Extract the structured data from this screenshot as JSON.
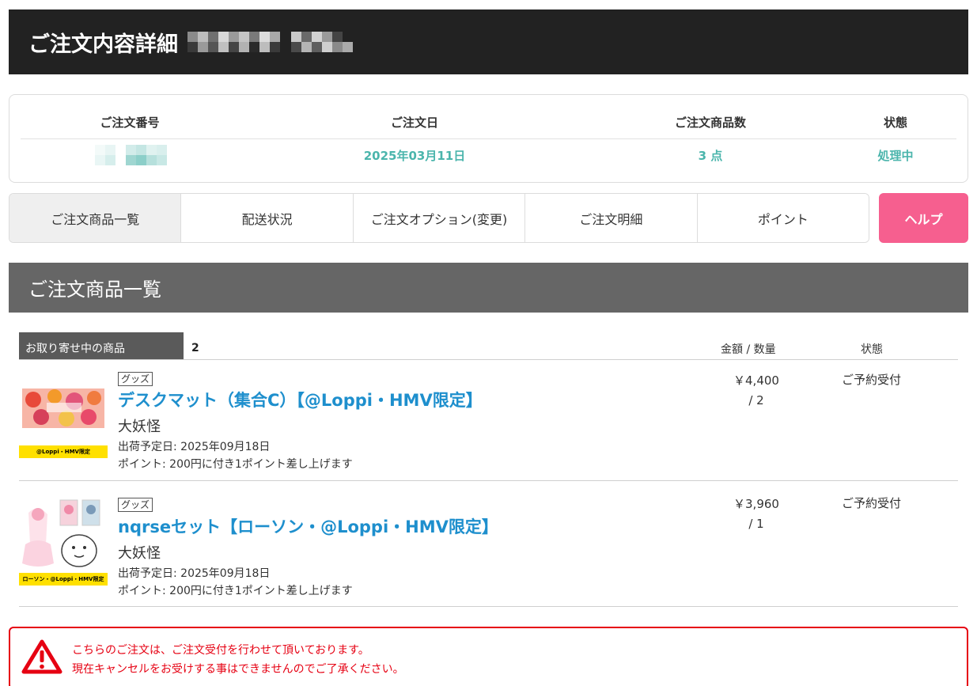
{
  "header": {
    "title": "ご注文内容詳細"
  },
  "summary": {
    "order_number_label": "ご注文番号",
    "order_date_label": "ご注文日",
    "order_date": "2025年03月11日",
    "item_count_label": "ご注文商品数",
    "item_count": "3 点",
    "status_label": "状態",
    "status": "処理中"
  },
  "tabs": [
    {
      "label": "ご注文商品一覧"
    },
    {
      "label": "配送状況"
    },
    {
      "label": "ご注文オプション(変更)"
    },
    {
      "label": "ご注文明細"
    },
    {
      "label": "ポイント"
    }
  ],
  "help_label": "ヘルプ",
  "section_title": "ご注文商品一覧",
  "list": {
    "group_label": "お取り寄せ中の商品",
    "group_count": "2",
    "amount_header": "金額 / 数量",
    "status_header": "状態"
  },
  "items": [
    {
      "category": "グッズ",
      "title": "デスクマット（集合C）【@Loppi・HMV限定】",
      "artist": "大妖怪",
      "ship_date": "出荷予定日: 2025年09月18日",
      "points": "ポイント: 200円に付き1ポイント差し上げます",
      "price": "￥4,400",
      "quantity": "/ 2",
      "status": "ご予約受付",
      "thumb_tag": "@Loppi・HMV限定"
    },
    {
      "category": "グッズ",
      "title": "nqrseセット【ローソン・@Loppi・HMV限定】",
      "artist": "大妖怪",
      "ship_date": "出荷予定日: 2025年09月18日",
      "points": "ポイント: 200円に付き1ポイント差し上げます",
      "price": "￥3,960",
      "quantity": "/ 1",
      "status": "ご予約受付",
      "thumb_tag": "ローソン・@Loppi・HMV限定"
    }
  ],
  "notice": {
    "line1": "こちらのご注文は、ご注文受付を行わせて頂いております。",
    "line2": "現在キャンセルをお受けする事はできませんのでご了承ください。"
  }
}
